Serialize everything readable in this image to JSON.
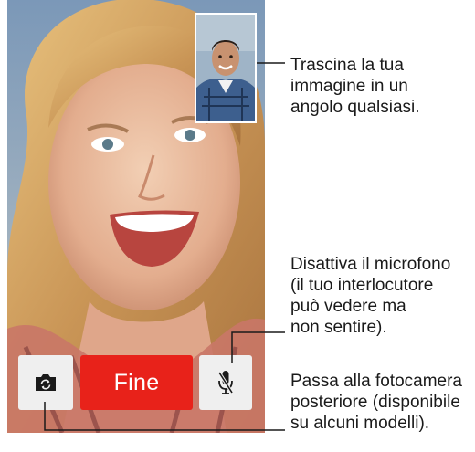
{
  "call": {
    "end_button_label": "Fine",
    "camera_icon": "camera-flip-icon",
    "mute_icon": "microphone-mute-icon",
    "end_button_color": "#e8221a",
    "control_bg_color": "#efefef"
  },
  "callouts": {
    "pip": "Trascina la tua\nimmagine in un\nangolo qualsiasi.",
    "mute": "Disattiva il microfono\n(il tuo interlocutore\npuò vedere ma\nnon sentire).",
    "camera": "Passa alla fotocamera\nposteriore (disponibile\nsu alcuni modelli)."
  }
}
